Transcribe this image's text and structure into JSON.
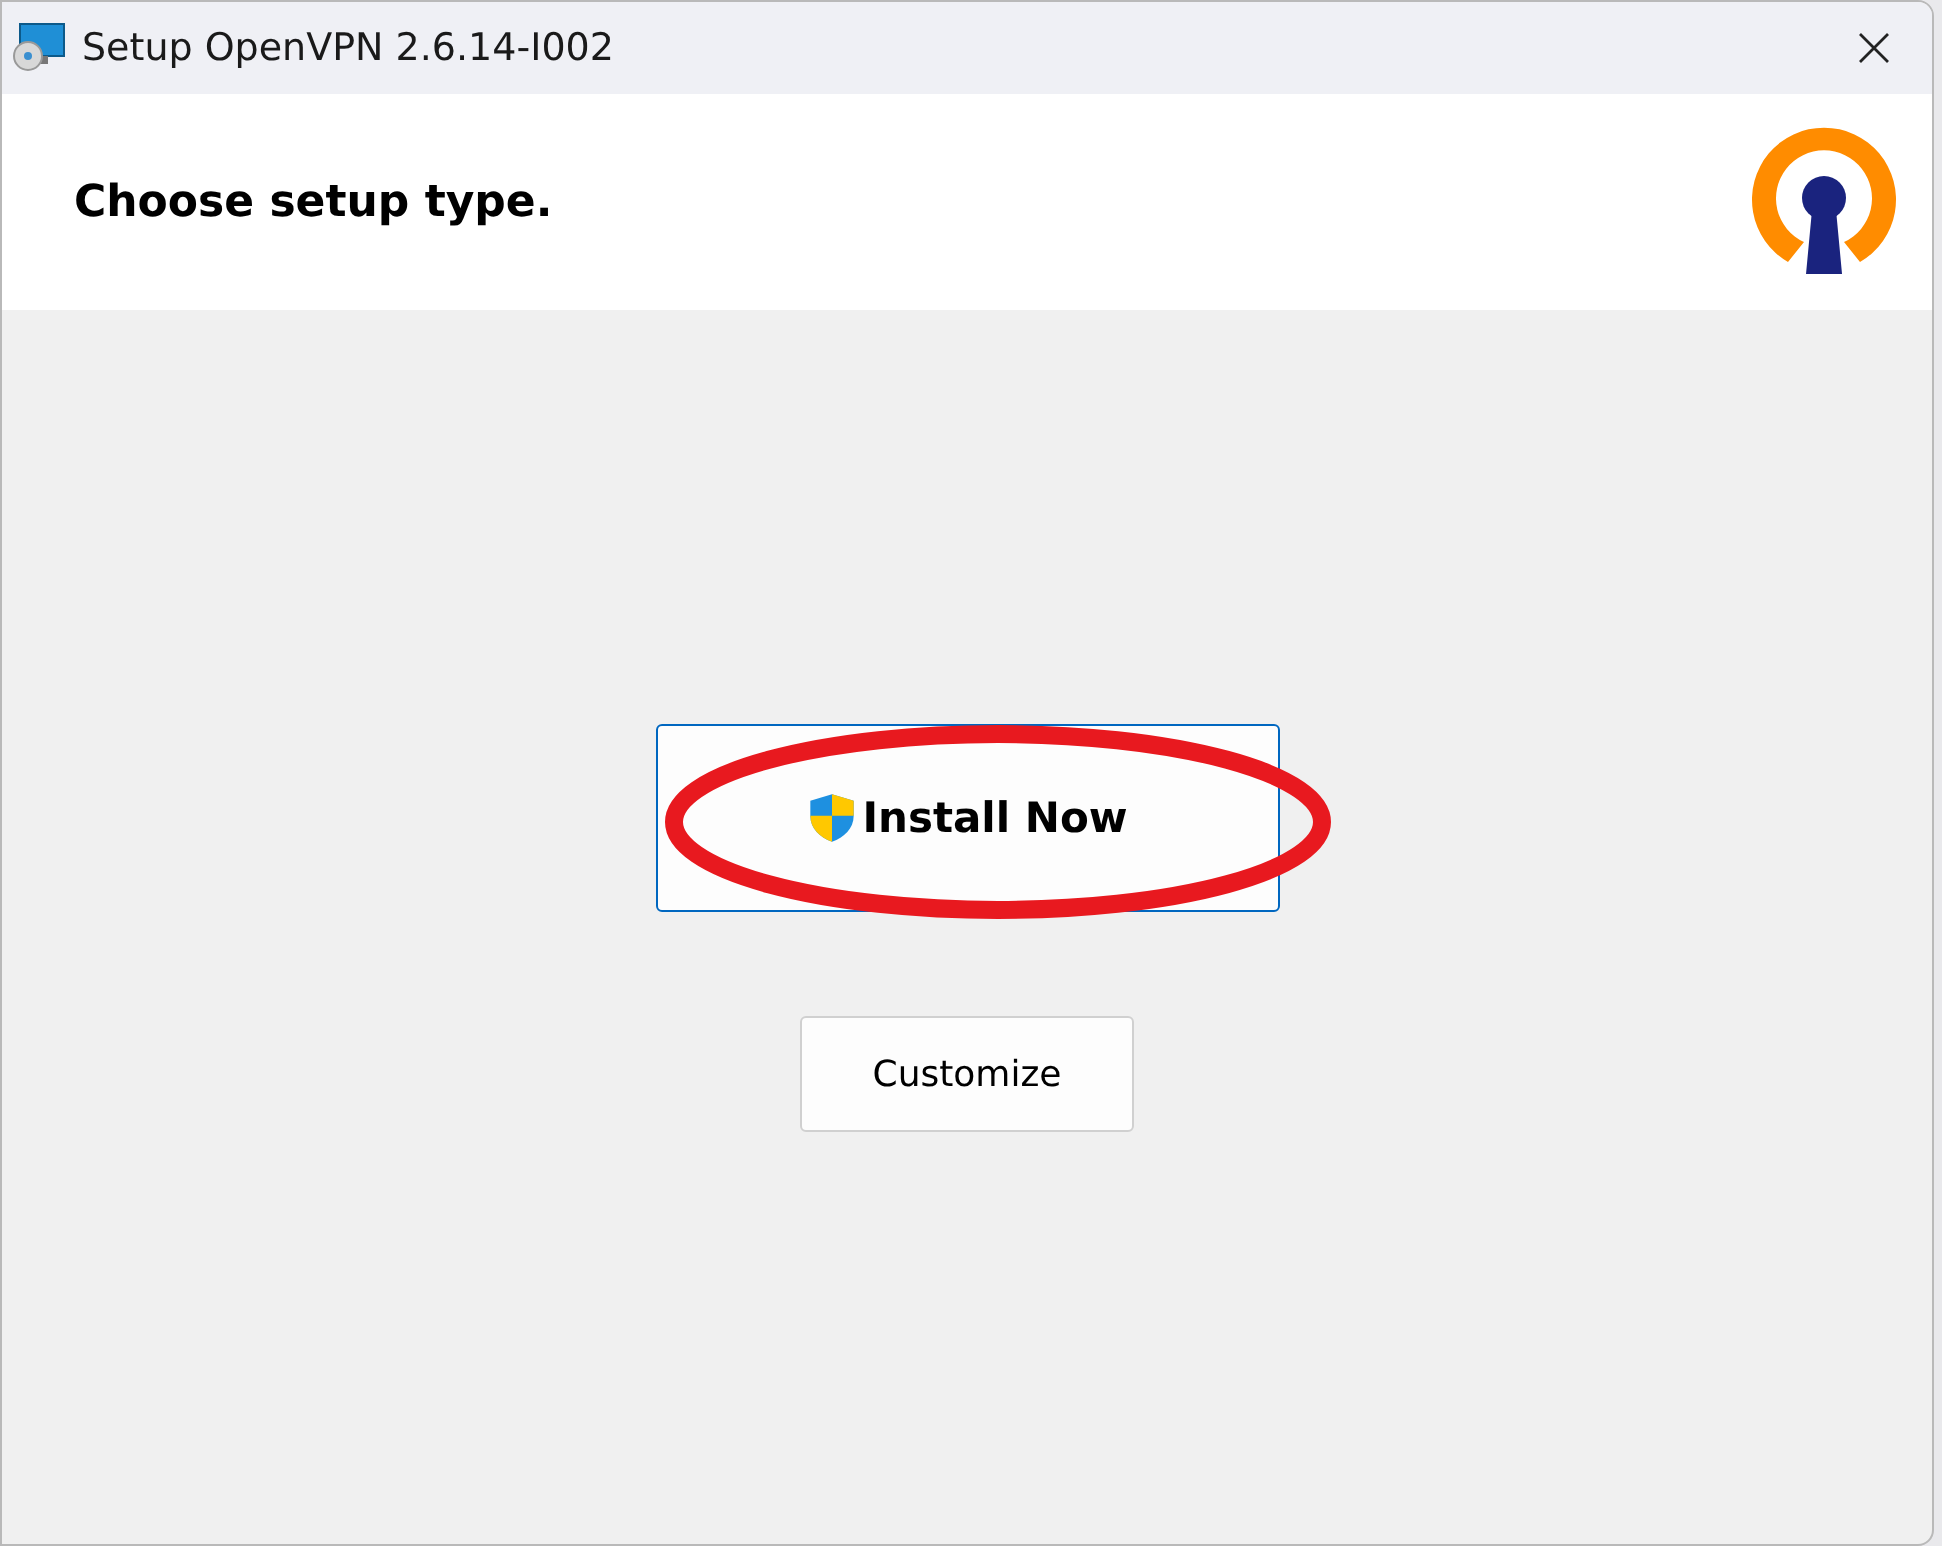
{
  "window": {
    "title": "Setup OpenVPN 2.6.14-I002"
  },
  "header": {
    "heading": "Choose setup type."
  },
  "buttons": [
    {
      "label": "Install Now",
      "kind": "elevated",
      "focused": true,
      "highlighted": true
    },
    {
      "label": "Customize",
      "kind": "plain",
      "focused": false,
      "highlighted": false
    }
  ]
}
